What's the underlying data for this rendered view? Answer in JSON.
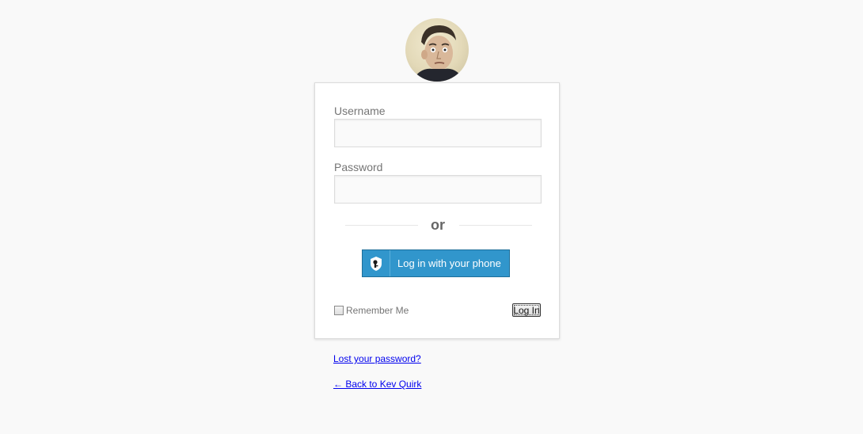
{
  "login": {
    "username_label": "Username",
    "username_value": "",
    "password_label": "Password",
    "password_value": "",
    "separator": "or",
    "phone_button_label": "Log in with your phone",
    "remember_label": "Remember Me",
    "remember_checked": false,
    "submit_label": "Log In"
  },
  "links": {
    "lost_password": "Lost your password?",
    "back_to_site": "← Back to Kev Quirk"
  },
  "colors": {
    "background": "#f9f9f9",
    "phone_button": "#3196cc",
    "link": "#0000ee"
  },
  "icons": {
    "avatar": "user-avatar-photo",
    "phone_button_icon": "shield-keyhole-icon"
  }
}
